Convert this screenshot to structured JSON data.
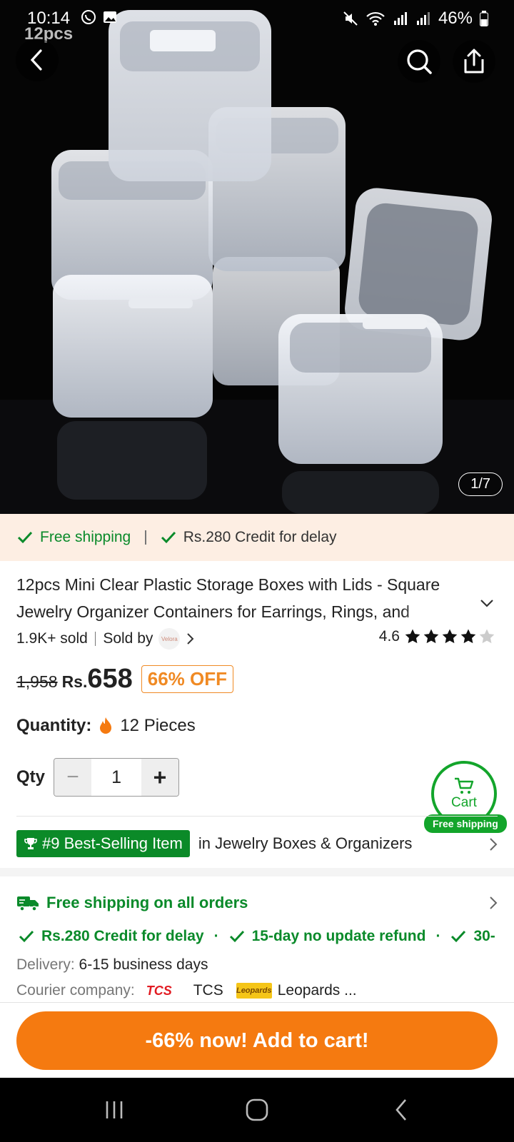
{
  "status_bar": {
    "time": "10:14",
    "battery": "46%"
  },
  "hero": {
    "overlay_label": "12pcs",
    "counter": "1/7"
  },
  "shipping_strip": {
    "free_shipping": "Free shipping",
    "credit": "Rs.280 Credit for delay"
  },
  "product": {
    "title": "12pcs Mini Clear Plastic Storage Boxes with Lids - Square Jewelry Organizer Containers for Earrings, Rings, and",
    "sold": "1.9K+ sold",
    "sold_by": "Sold by",
    "seller_logo_text": "Velora",
    "rating": "4.6",
    "rating_value": 4.6,
    "old_price": "1,958",
    "currency": "Rs.",
    "price": "658",
    "discount": "66% OFF",
    "quantity_label": "Quantity:",
    "quantity_value": "12 Pieces"
  },
  "qty": {
    "label": "Qty",
    "value": "1",
    "minus": "−",
    "plus": "+"
  },
  "cart_float": {
    "label": "Cart",
    "badge": "Free shipping"
  },
  "best_seller": {
    "badge": "#9 Best-Selling Item",
    "category": "in Jewelry Boxes & Organizers"
  },
  "shipping_info": {
    "title": "Free shipping on all orders",
    "services": [
      "Rs.280 Credit for delay",
      "15-day no update refund",
      "30-"
    ],
    "delivery_label": "Delivery:",
    "delivery_value": "6-15 business days",
    "courier_label": "Courier company:",
    "courier_1_logo": "TCS",
    "courier_1": "TCS",
    "courier_2_logo": "Leopards",
    "courier_2": "Leopards ..."
  },
  "cta": {
    "label": "-66% now! Add to cart!"
  },
  "colors": {
    "accent_orange": "#f57a10",
    "green": "#0a8a2a",
    "strip_bg": "#fdeee3"
  }
}
